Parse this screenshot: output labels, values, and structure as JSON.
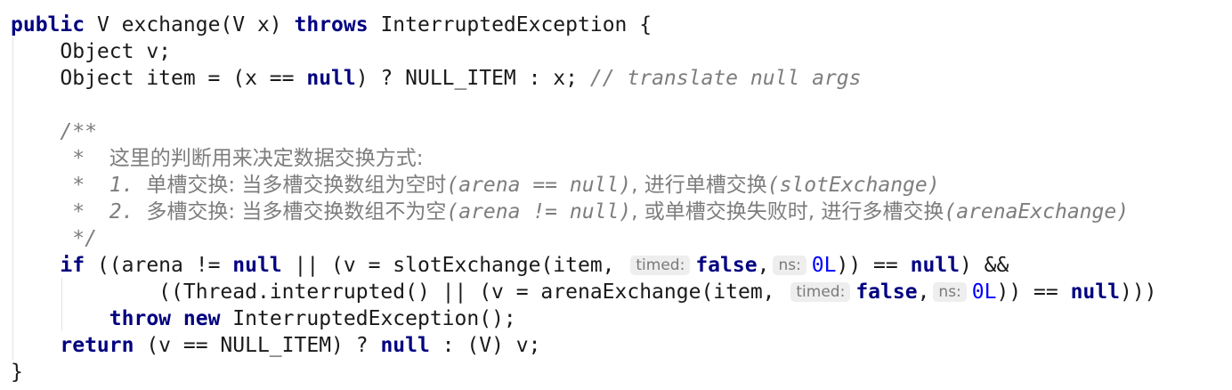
{
  "code": {
    "l1": {
      "kw_public": "public",
      "t1": " V exchange(V x) ",
      "kw_throws": "throws",
      "t2": " InterruptedException {"
    },
    "l2": {
      "t1": "    Object v;"
    },
    "l3": {
      "t1": "    Object item = (x == ",
      "kw_null": "null",
      "t2": ") ? NULL_ITEM : x; ",
      "comment": "// translate null args"
    },
    "l5": {
      "t1": "    /**"
    },
    "l6": {
      "star": "     *  ",
      "text": "这里的判断用来决定数据交换方式:"
    },
    "l7": {
      "star": "     *  ",
      "num": "1. ",
      "cjk1": "单槽交换: 当多槽交换数组为空时",
      "latin1": "(arena == null)",
      "cjk2": ", 进行单槽交换",
      "latin2": "(slotExchange)"
    },
    "l8": {
      "star": "     *  ",
      "num": "2. ",
      "cjk1": "多槽交换: 当多槽交换数组不为空",
      "latin1": "(arena != null)",
      "cjk2": ", 或单槽交换失败时, 进行多槽交换",
      "latin2": "(arenaExchange)"
    },
    "l9": {
      "t1": "     */"
    },
    "l10": {
      "indent": "    ",
      "kw_if": "if",
      "t1": " ((arena != ",
      "kw_null1": "null",
      "t2": " || (v = slotExchange(item, ",
      "hint_timed": "timed:",
      "kw_false": "false",
      "t3": ",",
      "hint_ns": "ns:",
      "num_0l": "0L",
      "t4": ")) == ",
      "kw_null2": "null",
      "t5": ") &&"
    },
    "l11": {
      "t1": "            ((Thread.interrupted() || (v = arenaExchange(item, ",
      "hint_timed": "timed:",
      "kw_false": "false",
      "t2": ",",
      "hint_ns": "ns:",
      "num_0l": "0L",
      "t3": ")) == ",
      "kw_null": "null",
      "t4": ")))"
    },
    "l12": {
      "indent": "        ",
      "kw_throw": "throw",
      "sp": " ",
      "kw_new": "new",
      "t1": " InterruptedException();"
    },
    "l13": {
      "indent": "    ",
      "kw_return": "return",
      "t1": " (v == NULL_ITEM) ? ",
      "kw_null": "null",
      "t2": " : (V) v;"
    },
    "l14": {
      "t1": "}"
    }
  }
}
